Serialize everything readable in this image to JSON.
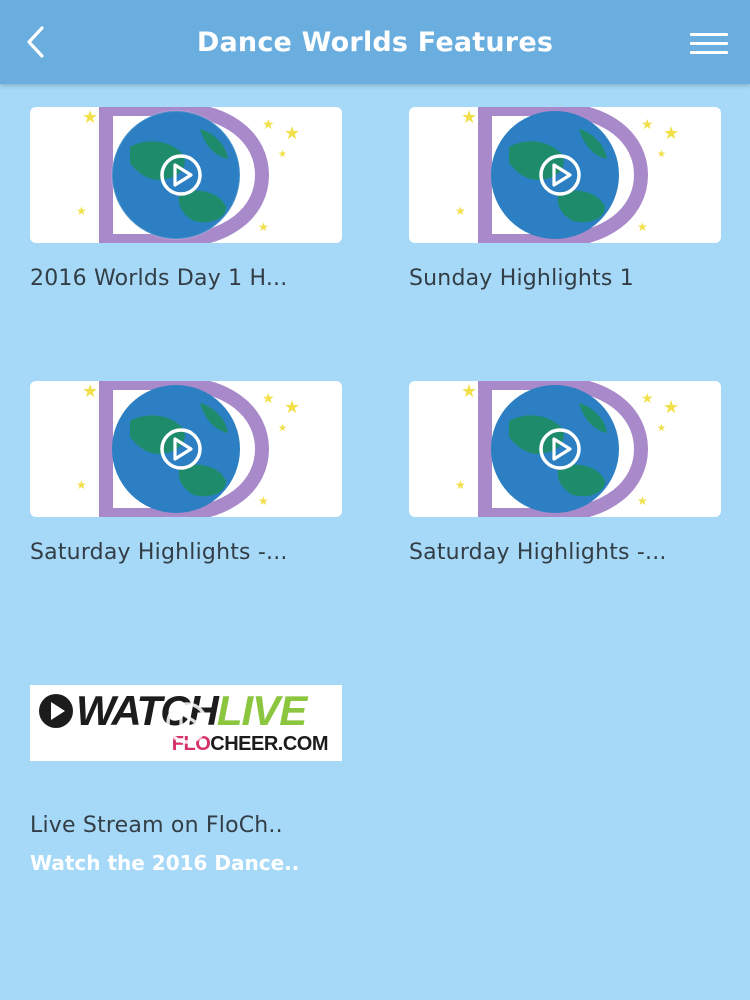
{
  "header": {
    "title": "Dance Worlds Features",
    "back_icon": "chevron-left-icon",
    "menu_icon": "hamburger-menu-icon"
  },
  "colors": {
    "header_bg": "#6aaedf",
    "page_bg": "#a6d9f7",
    "logo_d": "#a889c9",
    "globe_ocean": "#2c7fc2",
    "globe_land": "#1e8c6a",
    "stars": "#f2e04a"
  },
  "videos": [
    {
      "title": "2016 Worlds Day 1 H...",
      "thumbnail": "dance-worlds-d-logo"
    },
    {
      "title": "Sunday Highlights 1",
      "thumbnail": "dance-worlds-d-logo"
    },
    {
      "title": "Saturday Highlights -...",
      "thumbnail": "dance-worlds-d-logo"
    },
    {
      "title": "Saturday Highlights -...",
      "thumbnail": "dance-worlds-d-logo"
    }
  ],
  "live": {
    "banner_watch": "WATCH",
    "banner_live": "LIVE",
    "banner_site_a": "FLO",
    "banner_site_b": "CHEER.COM",
    "title": "Live Stream on FloCh..",
    "subtitle": "Watch the 2016 Dance.."
  }
}
